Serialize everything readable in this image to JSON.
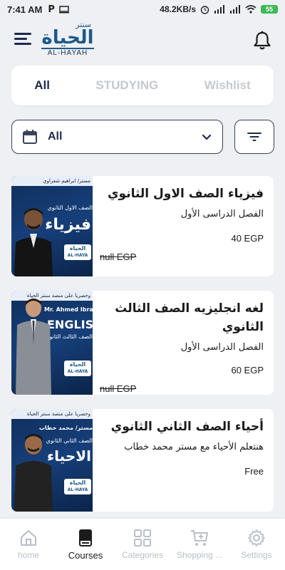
{
  "status_bar": {
    "time": "7:41 AM",
    "network_speed": "48.2KB/s",
    "battery": "55"
  },
  "header": {
    "logo_ar_top": "سنتر",
    "logo_ar": "الحياة",
    "logo_en": "AL-HAYAH"
  },
  "tabs": [
    {
      "label": "All",
      "active": true
    },
    {
      "label": "STUDYING",
      "active": false
    },
    {
      "label": "Wishlist",
      "active": false
    }
  ],
  "filter": {
    "selected": "All"
  },
  "courses": [
    {
      "title": "فيزياء الصف الاول الثانوي",
      "subtitle": "الفصل الدراسى الأول",
      "price": "40 EGP",
      "old_price": "null EGP",
      "thumb": {
        "banner": "مستر/ ابراهيم شعراوي",
        "sub": "الصف الاول الثانوي",
        "big": "فيزياء",
        "logo_ar": "الحياة",
        "logo_en": "AL-HAYA"
      }
    },
    {
      "title": "لغه انجليزيه الصف الثالث الثانوي",
      "subtitle": "الفصل الدراسى الأول",
      "price": "60 EGP",
      "old_price": "null EGP",
      "thumb": {
        "banner": "وحصريا على منصة سنتر الحياة",
        "name": "Mr. Ahmed Ibrahi",
        "big": "ENGLISH",
        "sub": "الصف الثالث الثانوي",
        "logo_ar": "الحياة",
        "logo_en": "AL-HAYA"
      }
    },
    {
      "title": "أحياء الصف الثاني الثانوي",
      "subtitle": "هنتعلم الأحياء مع مستر محمد خطاب",
      "price": "Free",
      "old_price": "",
      "thumb": {
        "banner": "وحصريا على منصة سنتر الحياة",
        "name": "مستر/ محمد خطاب",
        "sub": "الصف الثاني الثانوي",
        "big": "الاحياء",
        "logo_ar": "الحياة",
        "logo_en": "AL-HAYA"
      }
    }
  ],
  "bottom_nav": [
    {
      "label": "home",
      "icon": "home-icon",
      "active": false
    },
    {
      "label": "Courses",
      "icon": "book-icon",
      "active": true
    },
    {
      "label": "Categories",
      "icon": "grid-icon",
      "active": false
    },
    {
      "label": "Shopping ...",
      "icon": "cart-icon",
      "active": false
    },
    {
      "label": "Settings",
      "icon": "gear-icon",
      "active": false
    }
  ]
}
